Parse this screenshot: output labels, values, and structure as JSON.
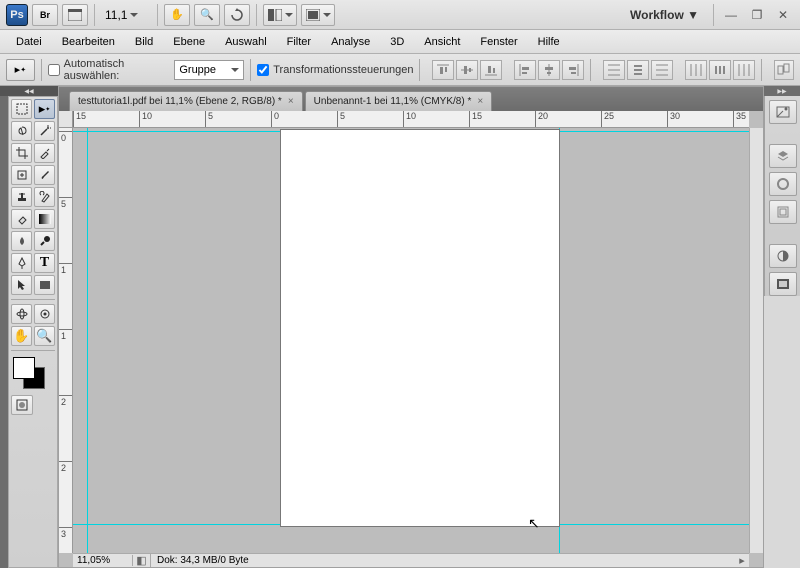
{
  "top": {
    "zoom_level": "11,1",
    "workflow_label": "Workflow"
  },
  "menu": [
    "Datei",
    "Bearbeiten",
    "Bild",
    "Ebene",
    "Auswahl",
    "Filter",
    "Analyse",
    "3D",
    "Ansicht",
    "Fenster",
    "Hilfe"
  ],
  "options": {
    "auto_select_label": "Automatisch auswählen:",
    "group_label": "Gruppe",
    "transform_label": "Transformationssteuerungen",
    "auto_select_checked": false,
    "transform_checked": true
  },
  "tabs": [
    {
      "label": "testtutoria1l.pdf bei 11,1% (Ebene 2, RGB/8) *"
    },
    {
      "label": "Unbenannt-1 bei 11,1% (CMYK/8) *"
    }
  ],
  "status": {
    "zoom": "11,05%",
    "doc_info": "Dok: 34,3 MB/0 Byte"
  },
  "ruler_h": [
    "15",
    "10",
    "5",
    "0",
    "5",
    "10",
    "15",
    "20",
    "25",
    "30",
    "35"
  ],
  "ruler_v": [
    "0",
    "5",
    "1",
    "1",
    "2",
    "2",
    "3"
  ]
}
